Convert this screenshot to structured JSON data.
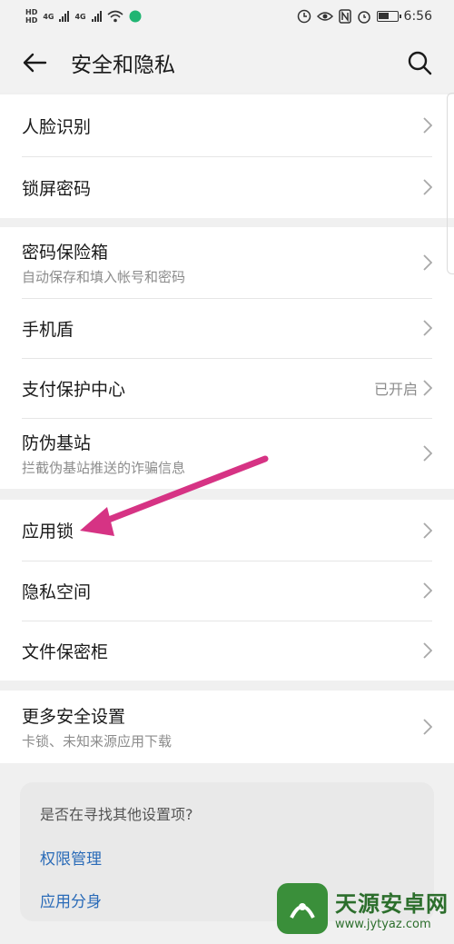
{
  "status_bar": {
    "network_labels": [
      "HD",
      "HD"
    ],
    "net_type_1": "4G",
    "net_type_2": "4G",
    "time": "6:56"
  },
  "app_bar": {
    "title": "安全和隐私",
    "back_icon": "back-arrow-icon",
    "search_icon": "search-icon"
  },
  "groups": [
    {
      "items": [
        {
          "label": "人脸识别"
        },
        {
          "label": "锁屏密码"
        }
      ]
    },
    {
      "items": [
        {
          "label": "密码保险箱",
          "sub": "自动保存和填入帐号和密码"
        },
        {
          "label": "手机盾"
        },
        {
          "label": "支付保护中心",
          "status": "已开启"
        },
        {
          "label": "防伪基站",
          "sub": "拦截伪基站推送的诈骗信息"
        }
      ]
    },
    {
      "items": [
        {
          "label": "应用锁"
        },
        {
          "label": "隐私空间"
        },
        {
          "label": "文件保密柜"
        }
      ]
    },
    {
      "items": [
        {
          "label": "更多安全设置",
          "sub": "卡锁、未知来源应用下载"
        }
      ]
    }
  ],
  "suggestion": {
    "title": "是否在寻找其他设置项?",
    "links": [
      "权限管理",
      "应用分身"
    ]
  },
  "annotation": {
    "color": "#d63384",
    "icon": "pointer-arrow"
  },
  "watermark": {
    "text": "天源安卓网",
    "url": "www.jytyaz.com"
  },
  "colors": {
    "accent_link": "#2a6bb8",
    "background": "#f0f0f0"
  }
}
